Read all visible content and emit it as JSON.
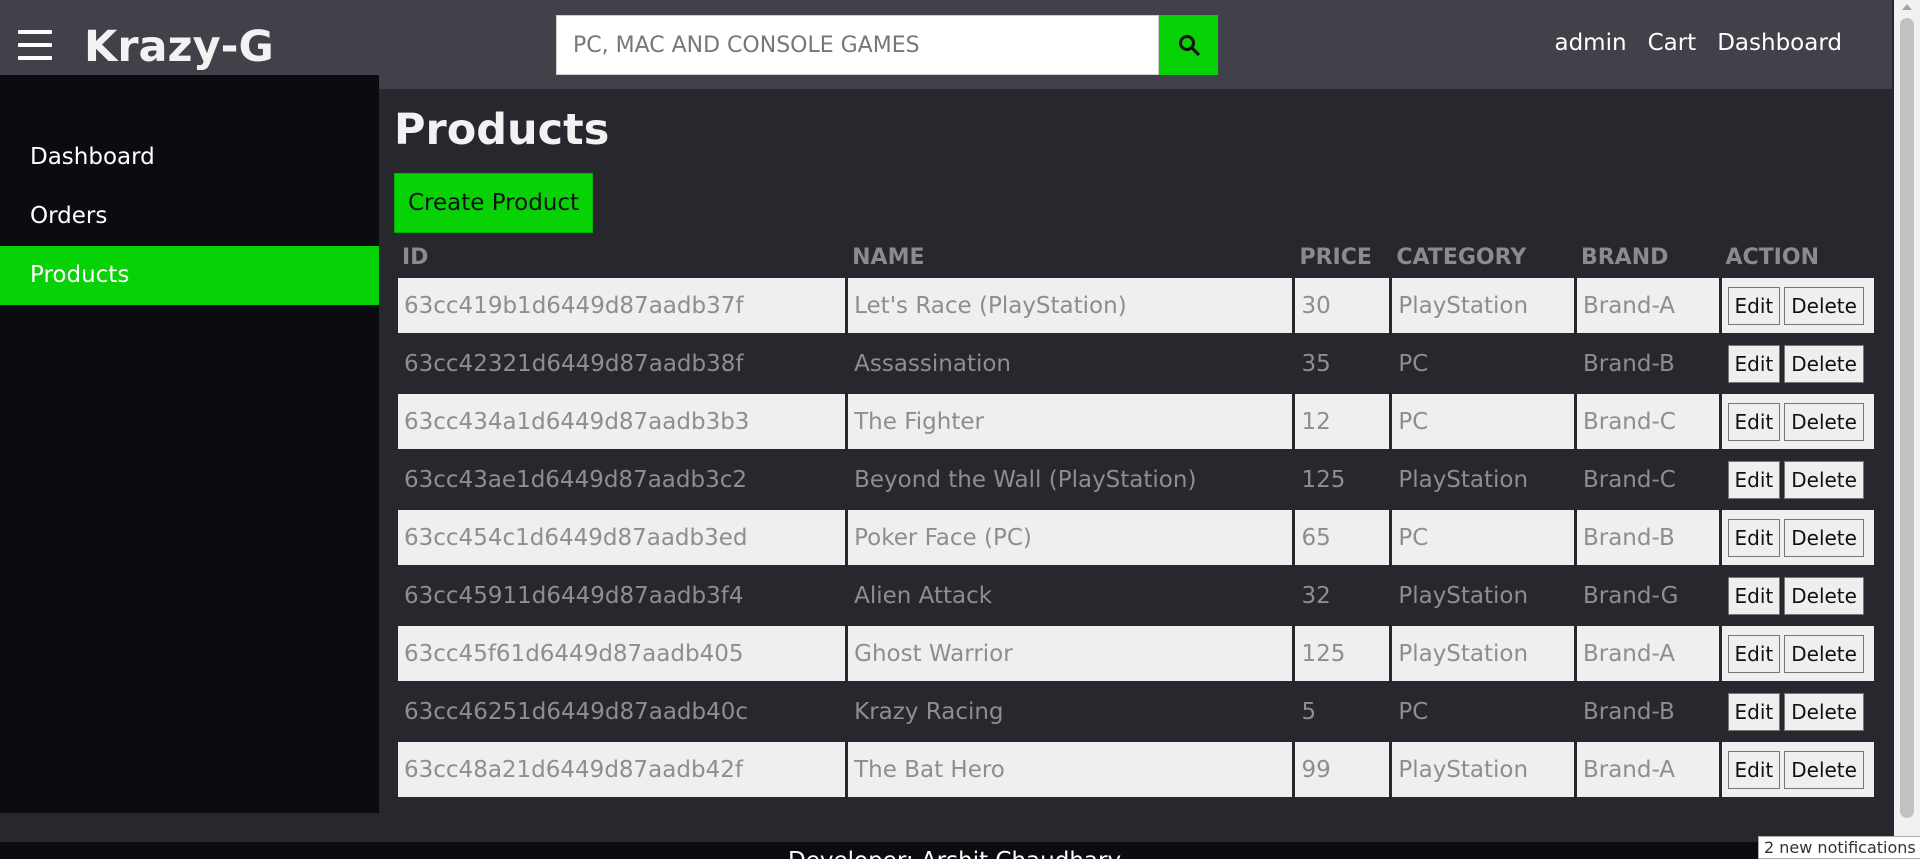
{
  "header": {
    "brand": "Krazy-G",
    "search_placeholder": "PC, MAC AND CONSOLE GAMES",
    "nav": {
      "admin": "admin",
      "cart": "Cart",
      "dashboard": "Dashboard"
    }
  },
  "sidebar": {
    "items": [
      {
        "label": "Dashboard",
        "active": false
      },
      {
        "label": "Orders",
        "active": false
      },
      {
        "label": "Products",
        "active": true
      }
    ]
  },
  "main": {
    "title": "Products",
    "create_button": "Create Product",
    "columns": [
      "ID",
      "NAME",
      "PRICE",
      "CATEGORY",
      "BRAND",
      "ACTION"
    ],
    "edit_label": "Edit",
    "delete_label": "Delete",
    "rows": [
      {
        "id": "63cc419b1d6449d87aadb37f",
        "name": "Let's Race (PlayStation)",
        "price": "30",
        "category": "PlayStation",
        "brand": "Brand-A"
      },
      {
        "id": "63cc42321d6449d87aadb38f",
        "name": "Assassination",
        "price": "35",
        "category": "PC",
        "brand": "Brand-B"
      },
      {
        "id": "63cc434a1d6449d87aadb3b3",
        "name": "The Fighter",
        "price": "12",
        "category": "PC",
        "brand": "Brand-C"
      },
      {
        "id": "63cc43ae1d6449d87aadb3c2",
        "name": "Beyond the Wall (PlayStation)",
        "price": "125",
        "category": "PlayStation",
        "brand": "Brand-C"
      },
      {
        "id": "63cc454c1d6449d87aadb3ed",
        "name": "Poker Face (PC)",
        "price": "65",
        "category": "PC",
        "brand": "Brand-B"
      },
      {
        "id": "63cc45911d6449d87aadb3f4",
        "name": "Alien Attack",
        "price": "32",
        "category": "PlayStation",
        "brand": "Brand-G"
      },
      {
        "id": "63cc45f61d6449d87aadb405",
        "name": "Ghost Warrior",
        "price": "125",
        "category": "PlayStation",
        "brand": "Brand-A"
      },
      {
        "id": "63cc46251d6449d87aadb40c",
        "name": "Krazy Racing",
        "price": "5",
        "category": "PC",
        "brand": "Brand-B"
      },
      {
        "id": "63cc48a21d6449d87aadb42f",
        "name": "The Bat Hero",
        "price": "99",
        "category": "PlayStation",
        "brand": "Brand-A"
      }
    ]
  },
  "footer": {
    "text": "Developer: Arshit Chaudhary"
  },
  "notifications": {
    "text": "2 new notifications"
  },
  "icons": {
    "menu": "hamburger-menu-icon",
    "search": "search-icon"
  },
  "colors": {
    "accent": "#06d206",
    "header_bg": "#414149",
    "sidebar_bg": "#0b0c0f",
    "page_bg": "#27272e"
  }
}
